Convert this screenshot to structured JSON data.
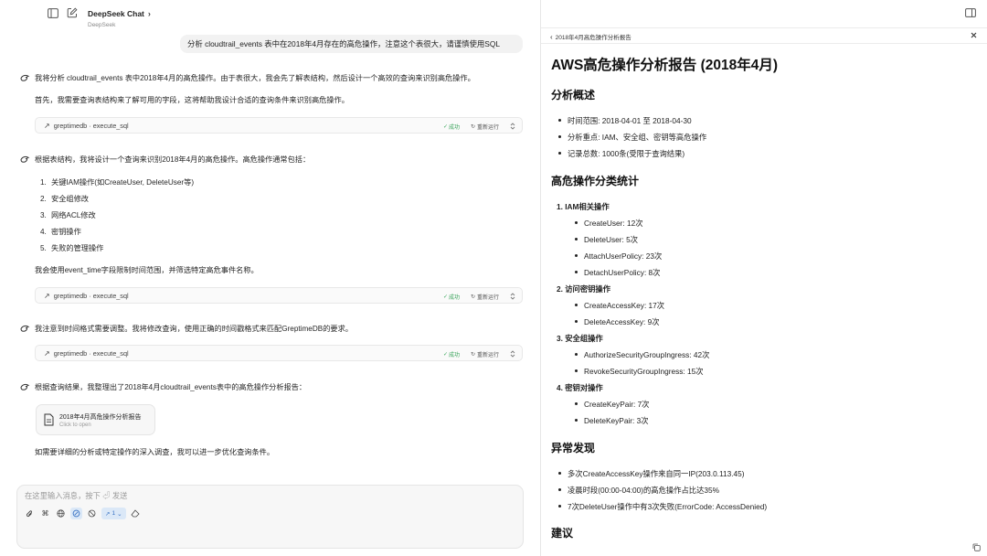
{
  "app": {
    "title": "DeepSeek Chat",
    "subtitle": "DeepSeek"
  },
  "chat": {
    "user_message": "分析 cloudtrail_events 表中在2018年4月存在的高危操作，注意这个表很大，请谨慎使用SQL",
    "a1_line1": "我将分析 cloudtrail_events 表中2018年4月的高危操作。由于表很大，我会先了解表结构，然后设计一个高效的查询来识别高危操作。",
    "a1_line2": "首先，我需要查询表结构来了解可用的字段，这将帮助我设计合适的查询条件来识别高危操作。",
    "a2_intro": "根据表结构，我将设计一个查询来识别2018年4月的高危操作。高危操作通常包括：",
    "a2_list": [
      {
        "n": "1.",
        "text": "关键IAM操作(如CreateUser, DeleteUser等)"
      },
      {
        "n": "2.",
        "text": "安全组修改"
      },
      {
        "n": "3.",
        "text": "网络ACL修改"
      },
      {
        "n": "4.",
        "text": "密钥操作"
      },
      {
        "n": "5.",
        "text": "失败的管理操作"
      }
    ],
    "a2_outro": "我会使用event_time字段限制时间范围，并筛选特定高危事件名称。",
    "a3": "我注意到时间格式需要调整。我将修改查询，使用正确的时间戳格式来匹配GreptimeDB的要求。",
    "a4": "根据查询结果，我整理出了2018年4月cloudtrail_events表中的高危操作分析报告：",
    "a5": "如需要详细的分析或特定操作的深入调查，我可以进一步优化查询条件。",
    "tool": {
      "name": "greptimedb · execute_sql",
      "status": "成功",
      "rerun": "重新运行"
    },
    "doc_card": {
      "title": "2018年4月高危操作分析报告",
      "subtitle": "Click to open"
    }
  },
  "composer": {
    "placeholder": "在这里输入消息，按下 ⏎ 发送",
    "skill_count": "1"
  },
  "panel": {
    "header": "2018年4月高危操作分析报告",
    "title": "AWS高危操作分析报告 (2018年4月)",
    "s1": "分析概述",
    "s1_items": [
      "时间范围: 2018-04-01 至 2018-04-30",
      "分析重点: IAM、安全组、密钥等高危操作",
      "记录总数: 1000条(受限于查询结果)"
    ],
    "s2": "高危操作分类统计",
    "groups": [
      {
        "label": "1.  IAM相关操作",
        "items": [
          "CreateUser: 12次",
          "DeleteUser: 5次",
          "AttachUserPolicy: 23次",
          "DetachUserPolicy: 8次"
        ]
      },
      {
        "label": "2.  访问密钥操作",
        "items": [
          "CreateAccessKey: 17次",
          "DeleteAccessKey: 9次"
        ]
      },
      {
        "label": "3.  安全组操作",
        "items": [
          "AuthorizeSecurityGroupIngress: 42次",
          "RevokeSecurityGroupIngress: 15次"
        ]
      },
      {
        "label": "4.  密钥对操作",
        "items": [
          "CreateKeyPair: 7次",
          "DeleteKeyPair: 3次"
        ]
      }
    ],
    "s3": "异常发现",
    "s3_items": [
      "多次CreateAccessKey操作来自同一IP(203.0.113.45)",
      "凌晨时段(00:00-04:00)的高危操作占比达35%",
      "7次DeleteUser操作中有3次失败(ErrorCode: AccessDenied)"
    ],
    "s4": "建议"
  }
}
